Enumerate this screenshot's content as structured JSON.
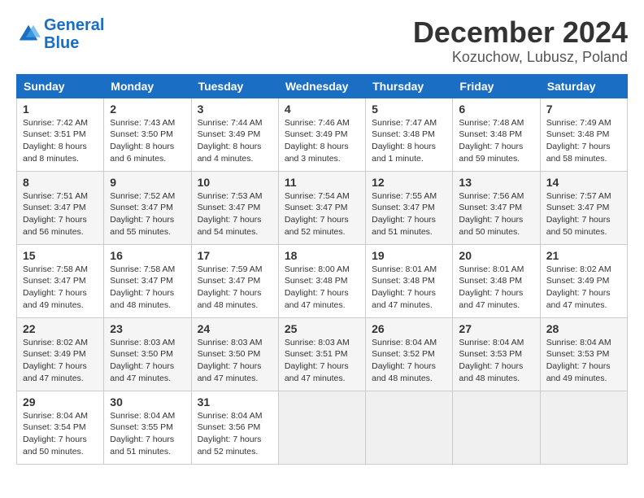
{
  "header": {
    "logo_line1": "General",
    "logo_line2": "Blue",
    "title": "December 2024",
    "subtitle": "Kozuchow, Lubusz, Poland"
  },
  "weekdays": [
    "Sunday",
    "Monday",
    "Tuesday",
    "Wednesday",
    "Thursday",
    "Friday",
    "Saturday"
  ],
  "weeks": [
    [
      {
        "day": "1",
        "sunrise": "Sunrise: 7:42 AM",
        "sunset": "Sunset: 3:51 PM",
        "daylight": "Daylight: 8 hours and 8 minutes."
      },
      {
        "day": "2",
        "sunrise": "Sunrise: 7:43 AM",
        "sunset": "Sunset: 3:50 PM",
        "daylight": "Daylight: 8 hours and 6 minutes."
      },
      {
        "day": "3",
        "sunrise": "Sunrise: 7:44 AM",
        "sunset": "Sunset: 3:49 PM",
        "daylight": "Daylight: 8 hours and 4 minutes."
      },
      {
        "day": "4",
        "sunrise": "Sunrise: 7:46 AM",
        "sunset": "Sunset: 3:49 PM",
        "daylight": "Daylight: 8 hours and 3 minutes."
      },
      {
        "day": "5",
        "sunrise": "Sunrise: 7:47 AM",
        "sunset": "Sunset: 3:48 PM",
        "daylight": "Daylight: 8 hours and 1 minute."
      },
      {
        "day": "6",
        "sunrise": "Sunrise: 7:48 AM",
        "sunset": "Sunset: 3:48 PM",
        "daylight": "Daylight: 7 hours and 59 minutes."
      },
      {
        "day": "7",
        "sunrise": "Sunrise: 7:49 AM",
        "sunset": "Sunset: 3:48 PM",
        "daylight": "Daylight: 7 hours and 58 minutes."
      }
    ],
    [
      {
        "day": "8",
        "sunrise": "Sunrise: 7:51 AM",
        "sunset": "Sunset: 3:47 PM",
        "daylight": "Daylight: 7 hours and 56 minutes."
      },
      {
        "day": "9",
        "sunrise": "Sunrise: 7:52 AM",
        "sunset": "Sunset: 3:47 PM",
        "daylight": "Daylight: 7 hours and 55 minutes."
      },
      {
        "day": "10",
        "sunrise": "Sunrise: 7:53 AM",
        "sunset": "Sunset: 3:47 PM",
        "daylight": "Daylight: 7 hours and 54 minutes."
      },
      {
        "day": "11",
        "sunrise": "Sunrise: 7:54 AM",
        "sunset": "Sunset: 3:47 PM",
        "daylight": "Daylight: 7 hours and 52 minutes."
      },
      {
        "day": "12",
        "sunrise": "Sunrise: 7:55 AM",
        "sunset": "Sunset: 3:47 PM",
        "daylight": "Daylight: 7 hours and 51 minutes."
      },
      {
        "day": "13",
        "sunrise": "Sunrise: 7:56 AM",
        "sunset": "Sunset: 3:47 PM",
        "daylight": "Daylight: 7 hours and 50 minutes."
      },
      {
        "day": "14",
        "sunrise": "Sunrise: 7:57 AM",
        "sunset": "Sunset: 3:47 PM",
        "daylight": "Daylight: 7 hours and 50 minutes."
      }
    ],
    [
      {
        "day": "15",
        "sunrise": "Sunrise: 7:58 AM",
        "sunset": "Sunset: 3:47 PM",
        "daylight": "Daylight: 7 hours and 49 minutes."
      },
      {
        "day": "16",
        "sunrise": "Sunrise: 7:58 AM",
        "sunset": "Sunset: 3:47 PM",
        "daylight": "Daylight: 7 hours and 48 minutes."
      },
      {
        "day": "17",
        "sunrise": "Sunrise: 7:59 AM",
        "sunset": "Sunset: 3:47 PM",
        "daylight": "Daylight: 7 hours and 48 minutes."
      },
      {
        "day": "18",
        "sunrise": "Sunrise: 8:00 AM",
        "sunset": "Sunset: 3:48 PM",
        "daylight": "Daylight: 7 hours and 47 minutes."
      },
      {
        "day": "19",
        "sunrise": "Sunrise: 8:01 AM",
        "sunset": "Sunset: 3:48 PM",
        "daylight": "Daylight: 7 hours and 47 minutes."
      },
      {
        "day": "20",
        "sunrise": "Sunrise: 8:01 AM",
        "sunset": "Sunset: 3:48 PM",
        "daylight": "Daylight: 7 hours and 47 minutes."
      },
      {
        "day": "21",
        "sunrise": "Sunrise: 8:02 AM",
        "sunset": "Sunset: 3:49 PM",
        "daylight": "Daylight: 7 hours and 47 minutes."
      }
    ],
    [
      {
        "day": "22",
        "sunrise": "Sunrise: 8:02 AM",
        "sunset": "Sunset: 3:49 PM",
        "daylight": "Daylight: 7 hours and 47 minutes."
      },
      {
        "day": "23",
        "sunrise": "Sunrise: 8:03 AM",
        "sunset": "Sunset: 3:50 PM",
        "daylight": "Daylight: 7 hours and 47 minutes."
      },
      {
        "day": "24",
        "sunrise": "Sunrise: 8:03 AM",
        "sunset": "Sunset: 3:50 PM",
        "daylight": "Daylight: 7 hours and 47 minutes."
      },
      {
        "day": "25",
        "sunrise": "Sunrise: 8:03 AM",
        "sunset": "Sunset: 3:51 PM",
        "daylight": "Daylight: 7 hours and 47 minutes."
      },
      {
        "day": "26",
        "sunrise": "Sunrise: 8:04 AM",
        "sunset": "Sunset: 3:52 PM",
        "daylight": "Daylight: 7 hours and 48 minutes."
      },
      {
        "day": "27",
        "sunrise": "Sunrise: 8:04 AM",
        "sunset": "Sunset: 3:53 PM",
        "daylight": "Daylight: 7 hours and 48 minutes."
      },
      {
        "day": "28",
        "sunrise": "Sunrise: 8:04 AM",
        "sunset": "Sunset: 3:53 PM",
        "daylight": "Daylight: 7 hours and 49 minutes."
      }
    ],
    [
      {
        "day": "29",
        "sunrise": "Sunrise: 8:04 AM",
        "sunset": "Sunset: 3:54 PM",
        "daylight": "Daylight: 7 hours and 50 minutes."
      },
      {
        "day": "30",
        "sunrise": "Sunrise: 8:04 AM",
        "sunset": "Sunset: 3:55 PM",
        "daylight": "Daylight: 7 hours and 51 minutes."
      },
      {
        "day": "31",
        "sunrise": "Sunrise: 8:04 AM",
        "sunset": "Sunset: 3:56 PM",
        "daylight": "Daylight: 7 hours and 52 minutes."
      },
      null,
      null,
      null,
      null
    ]
  ]
}
